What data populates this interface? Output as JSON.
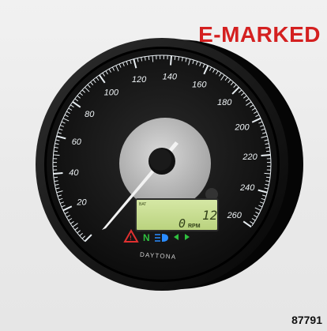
{
  "badge": {
    "text": "E-MARKED",
    "color": "#d42020"
  },
  "product_code": "87791",
  "gauge": {
    "brand": "DAYTONA",
    "scale_labels": [
      "20",
      "40",
      "60",
      "80",
      "100",
      "120",
      "140",
      "160",
      "180",
      "200",
      "220",
      "240",
      "260"
    ],
    "needle_value": 0,
    "lcd": {
      "top_left": "BAT",
      "top_right": "12",
      "main_value": "0",
      "unit": "RPM"
    },
    "indicators": [
      {
        "name": "warning-icon",
        "glyph": "△",
        "color": "#e03030"
      },
      {
        "name": "neutral-icon",
        "glyph": "N",
        "color": "#2fbf3f"
      },
      {
        "name": "high-beam-icon",
        "glyph": "≣D",
        "color": "#2a8cff"
      },
      {
        "name": "turn-signal-icon",
        "glyph": "⇆",
        "color": "#2fbf3f"
      }
    ]
  }
}
